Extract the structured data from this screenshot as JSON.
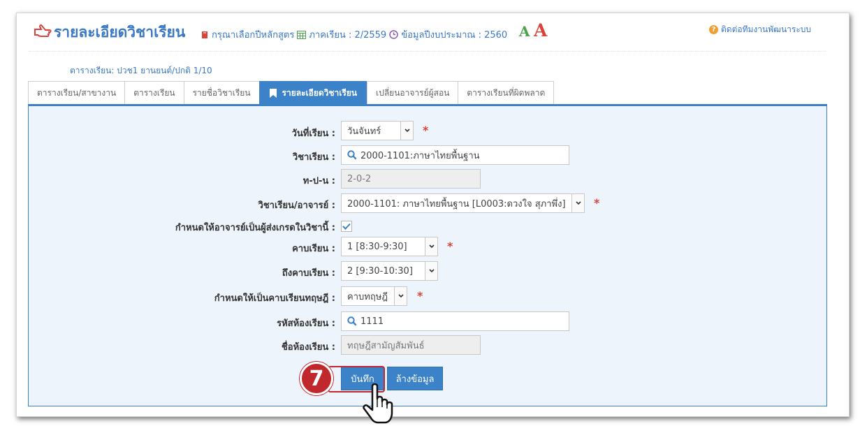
{
  "header": {
    "title": "รายละเอียดวิชาเรียน",
    "select_curriculum": "กรุณาเลือกปีหลักสูตร",
    "semester": "ภาคเรียน : 2/2559",
    "budget_year": "ข้อมูลปีงบประมาณ : 2560",
    "font_small": "A",
    "font_large": "A",
    "contact": "ติดต่อทีมงานพัฒนาระบบ"
  },
  "schedule_label": "ตารางเรียน: ปวช1 ยานยนต์/ปกติ 1/10",
  "tabs": [
    {
      "label": "ตารางเรียน/สาขางาน"
    },
    {
      "label": "ตารางเรียน"
    },
    {
      "label": "รายชื่อวิชาเรียน"
    },
    {
      "label": "รายละเอียดวิชาเรียน"
    },
    {
      "label": "เปลี่ยนอาจารย์ผู้สอน"
    },
    {
      "label": "ตารางเรียนที่ผิดพลาด"
    }
  ],
  "active_tab": 3,
  "form": {
    "day_label": "วันที่เรียน :",
    "day_value": "วันจันทร์",
    "subject_label": "วิชาเรียน :",
    "subject_value": "2000-1101:ภาษาไทยพื้นฐาน",
    "tpn_label": "ท-ป-น :",
    "tpn_value": "2-0-2",
    "subject_teacher_label": "วิชาเรียน/อาจารย์ :",
    "subject_teacher_value": "2000-1101: ภาษาไทยพื้นฐาน [L0003:ดวงใจ สุภาพึ่ง]",
    "grade_sender_label": "กำหนดให้อาจารย์เป็นผู้ส่งเกรดในวิชานี้ :",
    "grade_sender_checked": true,
    "period_label": "คาบเรียน :",
    "period_value": "1 [8:30-9:30]",
    "to_period_label": "ถึงคาบเรียน :",
    "to_period_value": "2 [9:30-10:30]",
    "theory_label": "กำหนดให้เป็นคาบเรียนทฤษฎี :",
    "theory_value": "คาบทฤษฎี",
    "room_code_label": "รหัสห้องเรียน :",
    "room_code_value": "1111",
    "room_name_label": "ชื่อห้องเรียน :",
    "room_name_value": "ทฤษฎีสามัญสัมพันธ์",
    "required_mark": "*",
    "save_label": "บันทึก",
    "clear_label": "ล้างข้อมูล"
  },
  "step_badge": "7",
  "colors": {
    "accent": "#3b82c8",
    "required": "#d9443a",
    "step": "#c0282d",
    "font_small": "#4aa34a"
  }
}
